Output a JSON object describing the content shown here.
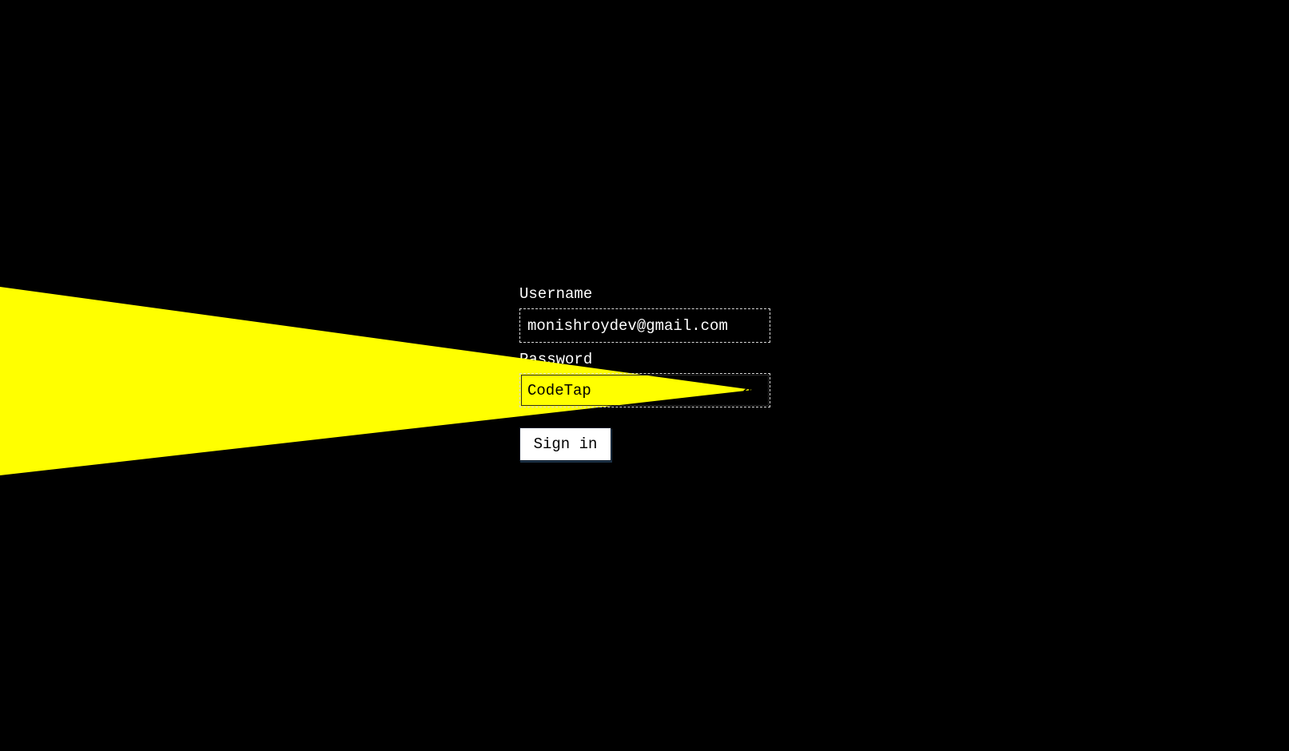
{
  "form": {
    "username": {
      "label": "Username",
      "value": "monishroydev@gmail.com"
    },
    "password": {
      "label": "Password",
      "value": "CodeTap",
      "visibility_icon": "eye-icon",
      "visible": true
    },
    "signin_label": "Sign in"
  },
  "colors": {
    "background": "#000000",
    "beam": "#ffff00",
    "text": "#ffffff",
    "button_bg": "#ffffff",
    "button_text": "#000000"
  }
}
